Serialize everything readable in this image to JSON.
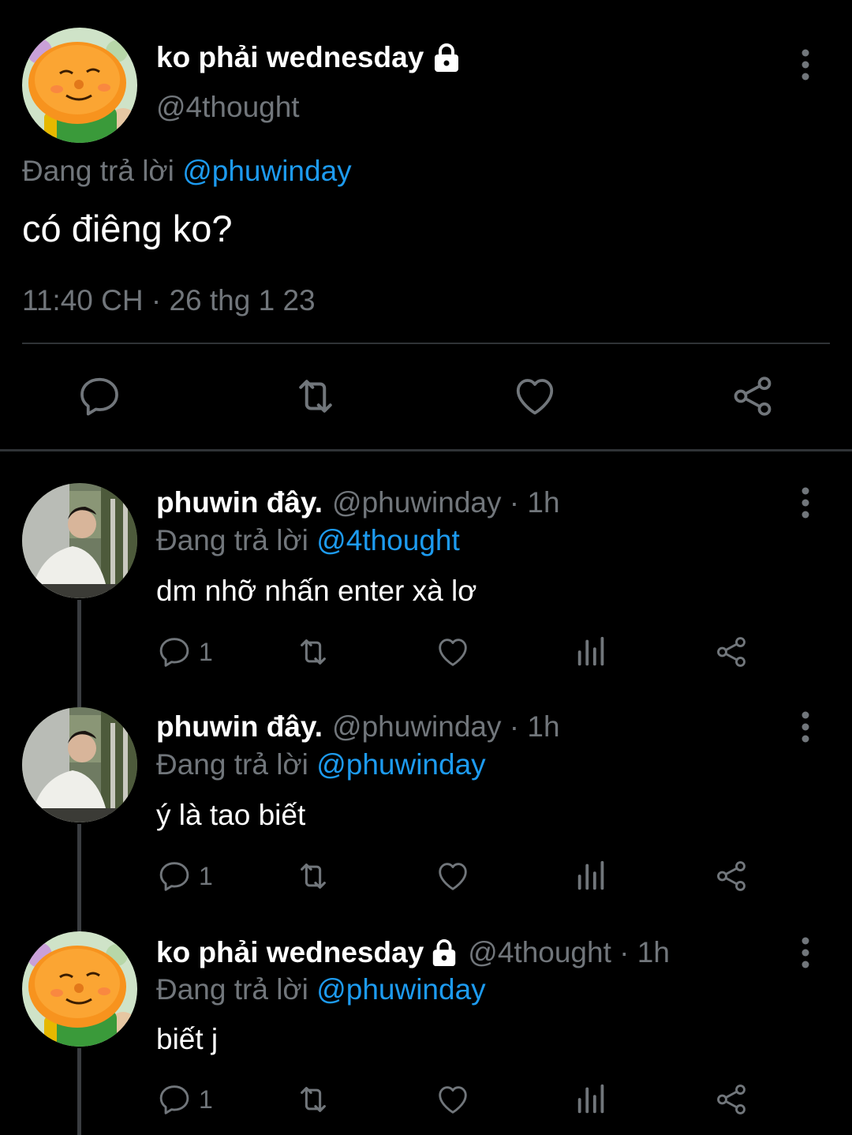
{
  "main_tweet": {
    "display_name": "ko phải wednesday",
    "handle": "@4thought",
    "replying_prefix": "Đang trả lời",
    "replying_to": "@phuwinday",
    "text": "có điêng ko?",
    "timestamp": "11:40 CH · 26 thg 1 23",
    "actions": [
      "reply-icon",
      "retweet-icon",
      "like-icon",
      "share-icon"
    ]
  },
  "replies": [
    {
      "display_name": "phuwin đây.",
      "handle_time": "@phuwinday · 1h",
      "replying_prefix": "Đang trả lời",
      "replying_to": "@4thought",
      "text": "dm nhỡ nhấn enter xà lơ",
      "reply_count": "1"
    },
    {
      "display_name": "phuwin đây.",
      "handle_time": "@phuwinday · 1h",
      "replying_prefix": "Đang trả lời",
      "replying_to": "@phuwinday",
      "text": "ý là tao biết",
      "reply_count": "1"
    },
    {
      "display_name": "ko phải wednesday",
      "handle_time": "@4thought · 1h",
      "replying_prefix": "Đang trả lời",
      "replying_to": "@phuwinday",
      "text": "biết j",
      "reply_count": "1"
    }
  ],
  "colors": {
    "background": "#000000",
    "text": "#ffffff",
    "muted": "#71767b",
    "accent": "#1d9bf0",
    "divider": "#2f3336"
  }
}
